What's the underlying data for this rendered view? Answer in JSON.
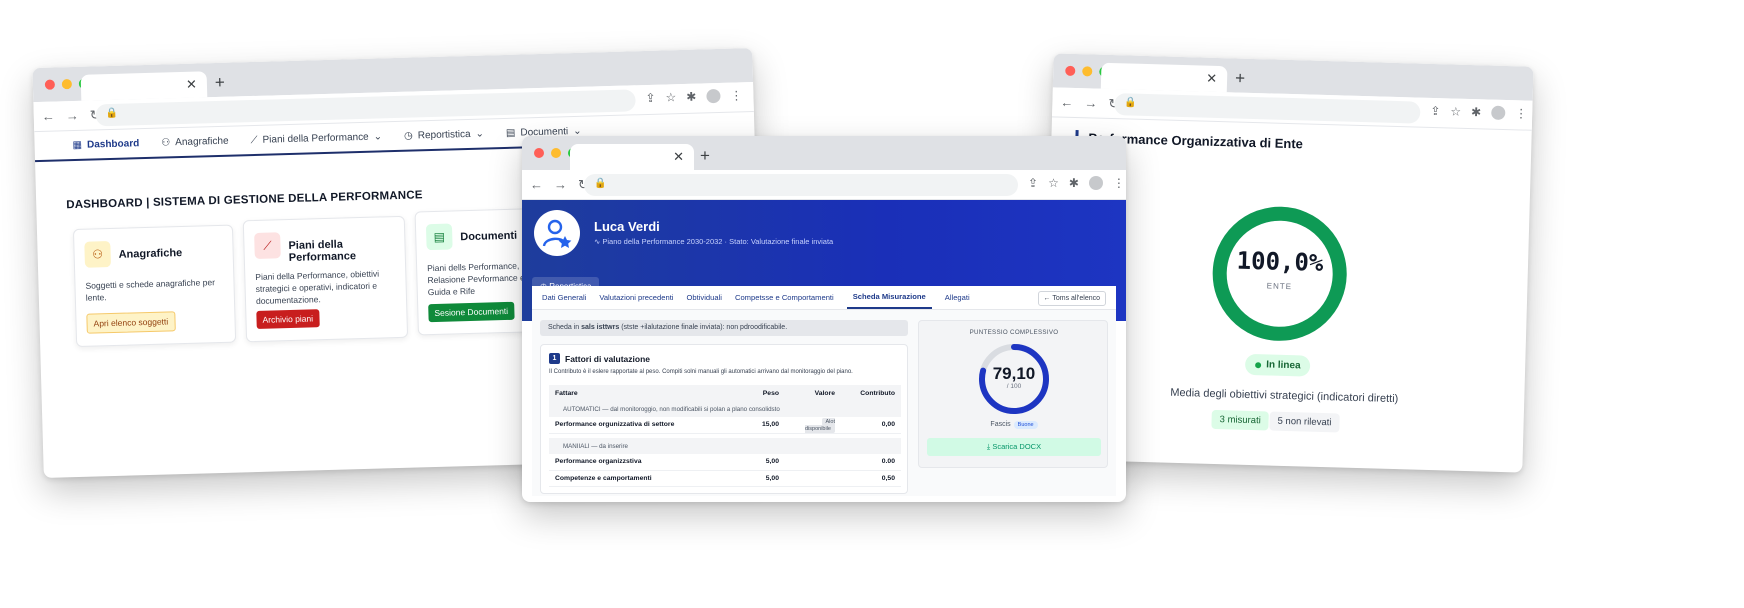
{
  "left_window": {
    "nav": [
      {
        "icon": "dashboard-icon",
        "label": "Dashboard",
        "active": true
      },
      {
        "icon": "people-icon",
        "label": "Anagrafiche"
      },
      {
        "icon": "chart-icon",
        "label": "Piani della Performance",
        "dropdown": true
      },
      {
        "icon": "clock-icon",
        "label": "Reportistica",
        "dropdown": true
      },
      {
        "icon": "document-icon",
        "label": "Documenti",
        "dropdown": true
      }
    ],
    "title": "DASHBOARD | SISTEMA DI GESTIONE DELLA PERFORMANCE",
    "cards": [
      {
        "icon": "people-icon",
        "title": "Anagrafiche",
        "description": "Soggetti e schede anagrafiche per lente.",
        "button": "Apri elenco soggetti"
      },
      {
        "icon": "chart-icon",
        "title": "Piani della Performance",
        "description": "Piani della Performance, obiettivi strategici e operativi, indicatori e documentazione.",
        "button": "Archivio piani"
      },
      {
        "icon": "document-icon",
        "title": "Documenti",
        "description": "Piani dells Performance, Relasione Pevformance e Linee Guida e Rife",
        "button": "Sesione Documenti"
      }
    ]
  },
  "center_window": {
    "profile": {
      "name": "Luca Verdi",
      "subtitle": "Piano della Performance 2030-2032 · Stato: Valutazione finale inviata"
    },
    "report_button": "Reportistica",
    "tabs": [
      "Dati Generali",
      "Valutazioni precedenti",
      "Obtividuali",
      "Competsse e Comportamenti",
      "Scheda Misurazione",
      "Allegati"
    ],
    "active_tab": "Scheda Misurazione",
    "back_button": "Toms all'elenco",
    "notice": {
      "prefix": "Scheda in",
      "bold": "sals isttwrs",
      "suffix": "(stste +ilalutazione finale inviata): non pdroodificabile."
    },
    "factors": {
      "number": "1",
      "title": "Fattori di valutazione",
      "note": "Il Contributo è il eslere rapportate al peso. Compiti solni manuali gli automatici arrivano dal monitoraggio del piano.",
      "columns": [
        "Fattare",
        "Peso",
        "Valore",
        "Contributo"
      ],
      "groups": [
        {
          "label": "AUTOMATICI — dal monitoroggio, non modificabili si polan a plano consolidsto",
          "rows": [
            {
              "name": "Performance orgunizzativa di settore",
              "weight": "15,00",
              "value": "Alot disponibile",
              "contribution": "0,00"
            }
          ]
        },
        {
          "label": "MANIIALI — da inserire",
          "rows": [
            {
              "name": "Performance organizzstiva",
              "weight": "5,00",
              "value": "",
              "contribution": "0.00"
            },
            {
              "name": "Competenze e camportamenti",
              "weight": "5,00",
              "value": "",
              "contribution": "0,50"
            }
          ]
        }
      ]
    },
    "score": {
      "label": "PUNTESSIO COMPLESSIVO",
      "value": "79,10",
      "max": "/ 100",
      "fraction": 0.791,
      "fascia_label": "Fascis",
      "fascia_value": "Buone",
      "download_button": "Scarica DOCX"
    }
  },
  "right_window": {
    "title": "Performance Organizzativa di Ente",
    "ring_value": "100,0%",
    "ring_fraction": 1.0,
    "ring_label": "ENTE",
    "status": "In linea",
    "description": "Media degli obiettivi strategici (indicatori diretti)",
    "chips": [
      "3 misurati",
      "5 non rilevati"
    ]
  },
  "colors": {
    "accent_navy": "#1e3a8a",
    "hero_blue": "#1a2fb8",
    "success_green": "#0e9a55",
    "danger_red": "#c81e1e"
  }
}
